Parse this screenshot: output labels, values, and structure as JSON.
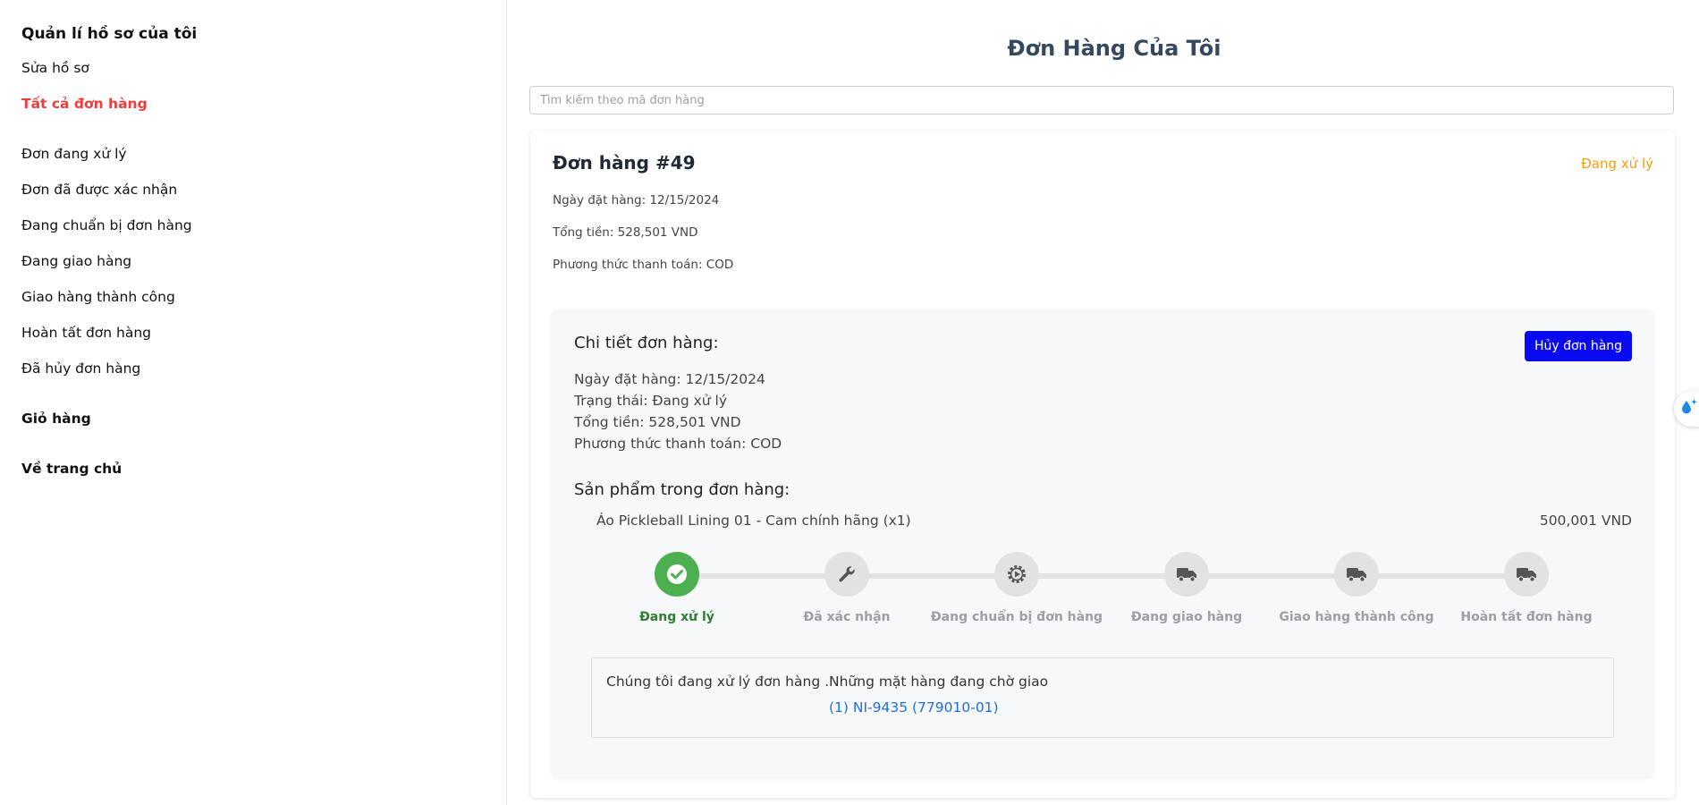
{
  "sidebar": {
    "heading": "Quản lí hồ sơ của tôi",
    "edit_profile": "Sửa hồ sơ",
    "all_orders": "Tất cả đơn hàng",
    "filters": [
      "Đơn đang xử lý",
      "Đơn đã được xác nhận",
      "Đang chuẩn bị đơn hàng",
      "Đang giao hàng",
      "Giao hàng thành công",
      "Hoàn tất đơn hàng",
      "Đã hủy đơn hàng"
    ],
    "cart": "Giỏ hàng",
    "home": "Về trang chủ"
  },
  "colors": {
    "active_link": "#ef3b3b",
    "status_pending": "#f59e0b",
    "primary_button": "#0a0af2",
    "step_done": "#4caf50",
    "link": "#1e6fd9"
  },
  "main": {
    "title": "Đơn Hàng Của Tôi",
    "search_placeholder": "Tìm kiếm theo mã đơn hàng"
  },
  "order": {
    "title": "Đơn hàng #49",
    "status": "Đang xử lý",
    "date_line": "Ngày đặt hàng: 12/15/2024",
    "total_line": "Tổng tiền: 528,501 VND",
    "payment_line": "Phương thức thanh toán: COD",
    "detail": {
      "heading": "Chi tiết đơn hàng:",
      "cancel_label": "Hủy đơn hàng",
      "date_line": "Ngày đặt hàng: 12/15/2024",
      "status_line": "Trạng thái: Đang xử lý",
      "total_line": "Tổng tiền: 528,501 VND",
      "payment_line": "Phương thức thanh toán: COD",
      "products_heading": "Sản phẩm trong đơn hàng:",
      "product_name": "Áo Pickleball Lining 01 - Cam chính hãng (x1)",
      "product_price": "500,001 VND"
    },
    "tracker": {
      "current_step": 1,
      "steps": [
        {
          "label": "Đang xử lý",
          "icon": "check-icon"
        },
        {
          "label": "Đã xác nhận",
          "icon": "wrench-icon"
        },
        {
          "label": "Đang chuẩn bị đơn hàng",
          "icon": "gear-icon"
        },
        {
          "label": "Đang giao hàng",
          "icon": "truck-icon"
        },
        {
          "label": "Giao hàng thành công",
          "icon": "truck-icon"
        },
        {
          "label": "Hoàn tất đơn hàng",
          "icon": "truck-icon"
        }
      ]
    },
    "info": {
      "message": "Chúng tôi đang xử lý đơn hàng .",
      "waiting_heading": "Những mặt hàng đang chờ giao",
      "item_link": "(1) NI-9435 (779010-01)"
    }
  },
  "floating_widget": {
    "icon": "droplet-sparkle-icon"
  }
}
